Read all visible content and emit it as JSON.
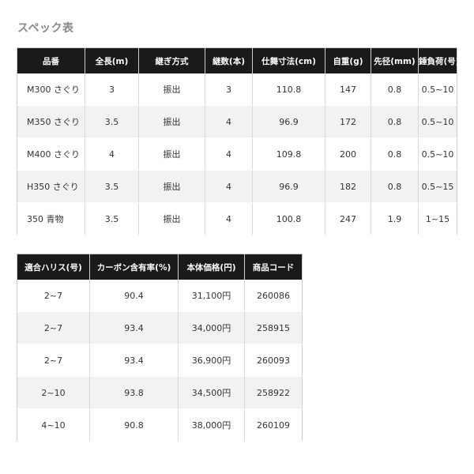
{
  "page": {
    "title": "スペック表"
  },
  "table1": {
    "headers": [
      "品番",
      "全長(m)",
      "継ぎ方式",
      "継数(本)",
      "仕舞寸法(cm)",
      "自重(g)",
      "先径(mm)",
      "錘負荷(号)"
    ],
    "rows": [
      [
        "M300 さぐり",
        "3",
        "振出",
        "3",
        "110.8",
        "147",
        "0.8",
        "0.5~10"
      ],
      [
        "M350 さぐり",
        "3.5",
        "振出",
        "4",
        "96.9",
        "172",
        "0.8",
        "0.5~10"
      ],
      [
        "M400 さぐり",
        "4",
        "振出",
        "4",
        "109.8",
        "200",
        "0.8",
        "0.5~10"
      ],
      [
        "H350 さぐり",
        "3.5",
        "振出",
        "4",
        "96.9",
        "182",
        "0.8",
        "0.5~15"
      ],
      [
        "350 青物",
        "3.5",
        "振出",
        "4",
        "100.8",
        "247",
        "1.9",
        "1~15"
      ]
    ]
  },
  "table2": {
    "headers": [
      "適合ハリス(号)",
      "カーボン含有率(%)",
      "本体価格(円)",
      "商品コード"
    ],
    "rows": [
      [
        "2~7",
        "90.4",
        "31,100円",
        "260086"
      ],
      [
        "2~7",
        "93.4",
        "34,000円",
        "258915"
      ],
      [
        "2~7",
        "93.4",
        "36,900円",
        "260093"
      ],
      [
        "2~10",
        "93.8",
        "34,500円",
        "258922"
      ],
      [
        "4~10",
        "90.8",
        "38,000円",
        "260109"
      ]
    ]
  }
}
